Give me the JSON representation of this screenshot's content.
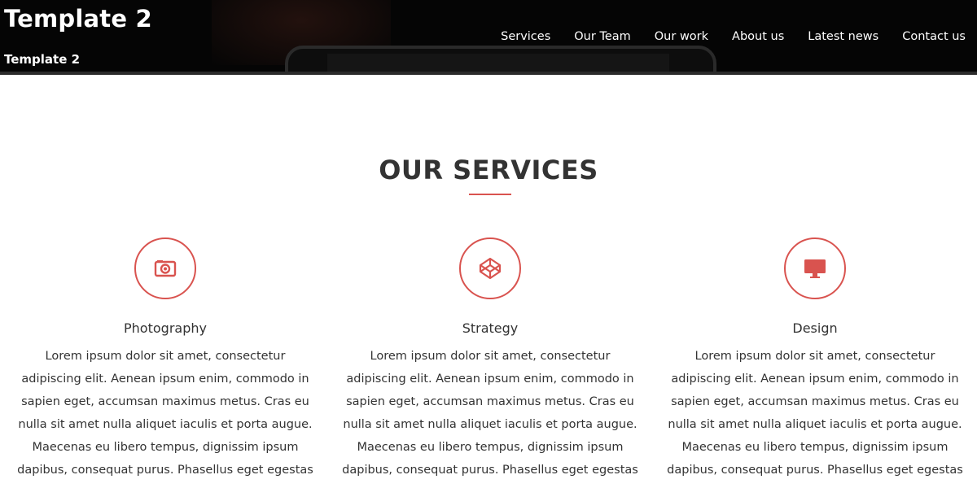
{
  "header": {
    "title": "Template 2",
    "subtitle": "Template 2",
    "nav": [
      {
        "label": "Services"
      },
      {
        "label": "Our Team"
      },
      {
        "label": "Our work"
      },
      {
        "label": "About us"
      },
      {
        "label": "Latest news"
      },
      {
        "label": "Contact us"
      }
    ]
  },
  "services_section": {
    "title": "OUR SERVICES",
    "accent_color": "#d9534f",
    "items": [
      {
        "icon": "camera-icon",
        "name": "Photography",
        "text": "Lorem ipsum dolor sit amet, consectetur adipiscing elit. Aenean ipsum enim, commodo in sapien eget, accumsan maximus metus. Cras eu nulla sit amet nulla aliquet iaculis et porta augue. Maecenas eu libero tempus, dignissim ipsum dapibus, consequat purus. Phasellus eget egestas ante."
      },
      {
        "icon": "codepen-icon",
        "name": "Strategy",
        "text": "Lorem ipsum dolor sit amet, consectetur adipiscing elit. Aenean ipsum enim, commodo in sapien eget, accumsan maximus metus. Cras eu nulla sit amet nulla aliquet iaculis et porta augue. Maecenas eu libero tempus, dignissim ipsum dapibus, consequat purus. Phasellus eget egestas ante."
      },
      {
        "icon": "desktop-icon",
        "name": "Design",
        "text": "Lorem ipsum dolor sit amet, consectetur adipiscing elit. Aenean ipsum enim, commodo in sapien eget, accumsan maximus metus. Cras eu nulla sit amet nulla aliquet iaculis et porta augue. Maecenas eu libero tempus, dignissim ipsum dapibus, consequat purus. Phasellus eget egestas ante."
      }
    ]
  }
}
